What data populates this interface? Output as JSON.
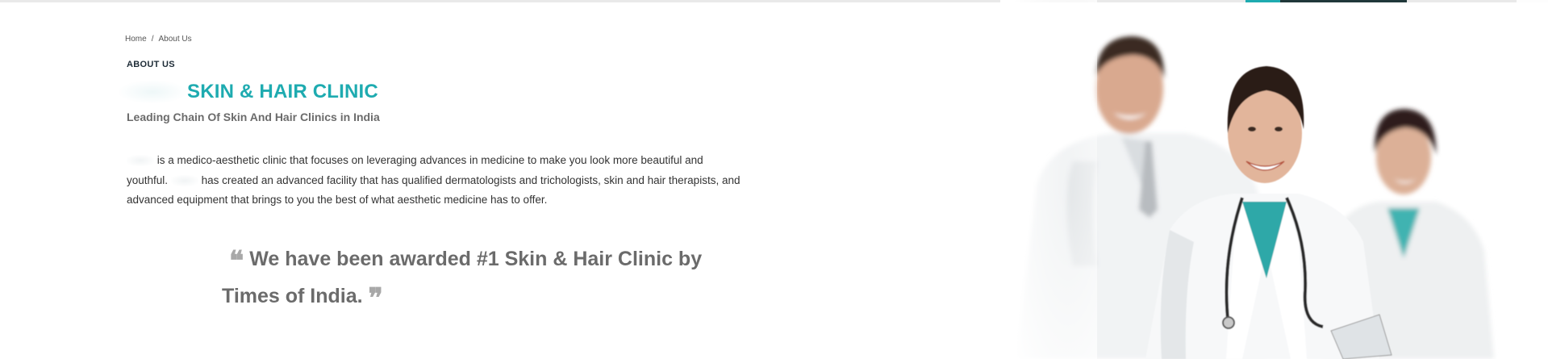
{
  "breadcrumb": {
    "home": "Home",
    "separator": "/",
    "current": "About Us"
  },
  "section_label": "ABOUT US",
  "title": "SKIN & HAIR CLINIC",
  "subtitle": "Leading Chain Of Skin And Hair Clinics in India",
  "paragraph": {
    "line1": "is a medico-aesthetic clinic that focuses on leveraging advances in medicine to make you look more beautiful and",
    "line2a": "youthful.",
    "line2b": "has created an advanced facility that has qualified dermatologists and trichologists, skin and hair therapists, and",
    "line3": "advanced equipment that brings to you the best of what aesthetic medicine has to offer."
  },
  "quote": {
    "line1": "We have been awarded #1 Skin & Hair Clinic by",
    "line2": "Times of India.",
    "open_mark": "❝",
    "close_mark": "❞"
  },
  "colors": {
    "accent": "#1eabb0",
    "dark_accent": "#20383a",
    "text": "#333333",
    "muted": "#6b6b6b"
  },
  "image": {
    "subject": "three-doctors-in-white-coats"
  }
}
